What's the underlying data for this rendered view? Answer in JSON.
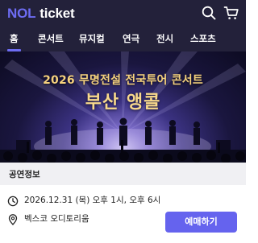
{
  "app": {
    "logo_part1": "NOL",
    "logo_part2": "ticket"
  },
  "header_icons": [
    "search-icon",
    "cart-icon"
  ],
  "categories": [
    {
      "label": "홈",
      "active": true
    },
    {
      "label": "콘서트",
      "active": false
    },
    {
      "label": "뮤지컬",
      "active": false
    },
    {
      "label": "연극",
      "active": false
    },
    {
      "label": "전시",
      "active": false
    },
    {
      "label": "스포츠",
      "active": false
    }
  ],
  "banner": {
    "title": "2026 무명전설 전국투어 콘서트",
    "subtitle": "부산 앵콜"
  },
  "info": {
    "section_title": "공연정보",
    "datetime": "2026.12.31 (목) 오후 1시, 오후 6시",
    "venue": "벡스코 오디토리움"
  },
  "actions": {
    "book_label": "예매하기"
  },
  "colors": {
    "header_bg": "#23213a",
    "accent": "#6563ee",
    "banner_text": "#f6d27e"
  }
}
